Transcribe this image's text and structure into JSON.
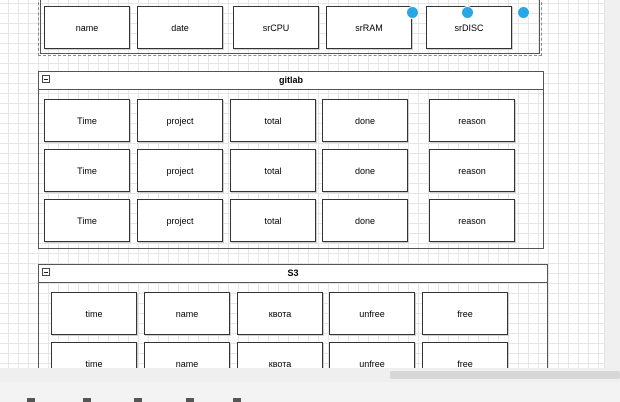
{
  "colors": {
    "handle": "#29a6e6",
    "grid": "#e6e6e6",
    "border": "#333333"
  },
  "top_group": {
    "cells": [
      "name",
      "date",
      "srCPU",
      "srRAM",
      "srDISC"
    ]
  },
  "gitlab": {
    "title": "gitlab",
    "rows": [
      [
        "Time",
        "project",
        "total",
        "done",
        "reason"
      ],
      [
        "Time",
        "project",
        "total",
        "done",
        "reason"
      ],
      [
        "Time",
        "project",
        "total",
        "done",
        "reason"
      ]
    ]
  },
  "s3": {
    "title": "S3",
    "rows": [
      [
        "time",
        "name",
        "квота",
        "unfree",
        "free"
      ],
      [
        "time",
        "name",
        "квота",
        "unfree",
        "free"
      ]
    ]
  }
}
